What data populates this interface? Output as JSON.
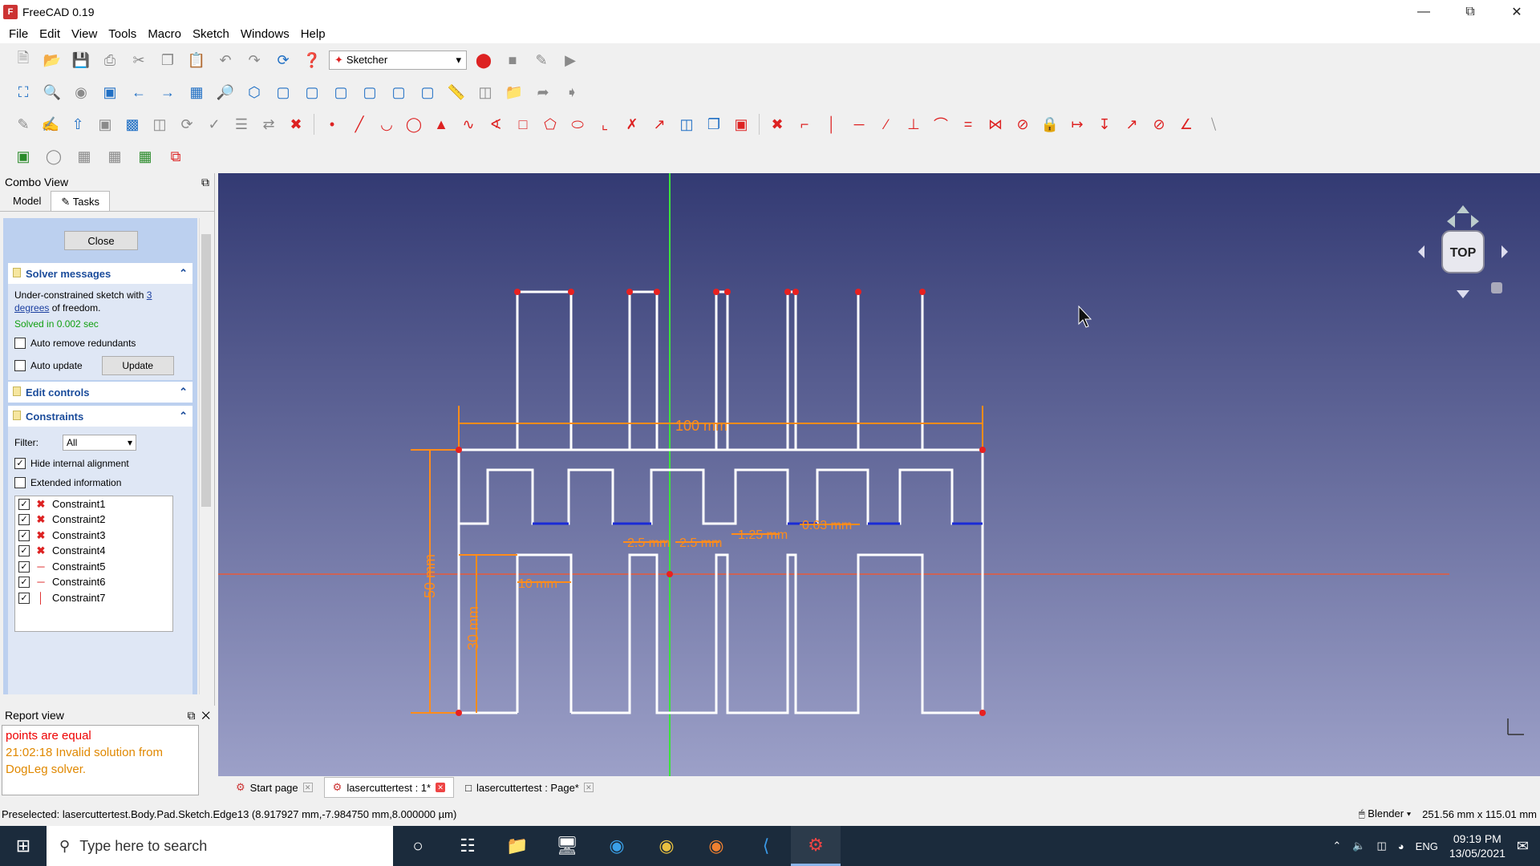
{
  "window": {
    "title": "FreeCAD 0.19"
  },
  "menu": [
    "File",
    "Edit",
    "View",
    "Tools",
    "Macro",
    "Sketch",
    "Windows",
    "Help"
  ],
  "toolbar": {
    "workbench": "Sketcher"
  },
  "combo": {
    "title": "Combo View",
    "tabs": [
      "Model",
      "Tasks"
    ],
    "close_label": "Close",
    "solver": {
      "title": "Solver messages",
      "msg_prefix": "Under-constrained sketch with",
      "msg_link": "3 degrees",
      "msg_suffix": "of freedom.",
      "solved": "Solved in 0.002 sec",
      "auto_remove": "Auto remove redundants",
      "auto_update": "Auto update",
      "update_label": "Update"
    },
    "edit_controls_title": "Edit controls",
    "constraints": {
      "title": "Constraints",
      "filter_label": "Filter:",
      "filter_value": "All",
      "hide_internal": "Hide internal alignment",
      "extended_info": "Extended information",
      "items": [
        "Constraint1",
        "Constraint2",
        "Constraint3",
        "Constraint4",
        "Constraint5",
        "Constraint6",
        "Constraint7"
      ]
    }
  },
  "report": {
    "title": "Report view",
    "line1": "points are equal",
    "line2": "21:02:18  Invalid solution from",
    "line3": "DogLeg solver."
  },
  "view": {
    "navcube_face": "TOP",
    "dims": {
      "width": "100 mm",
      "height": "50 mm",
      "inner_h": "30 mm",
      "slot_w": "10 mm",
      "d1": "2.5 mm",
      "d2": "2.5 mm",
      "d3": "1.25 mm",
      "d4": "0.63 mm"
    }
  },
  "doc_tabs": [
    {
      "label": "Start page"
    },
    {
      "label": "lasercuttertest : 1*"
    },
    {
      "label": "lasercuttertest : Page*"
    }
  ],
  "status": {
    "preselected": "Preselected: lasercuttertest.Body.Pad.Sketch.Edge13 (8.917927 mm,-7.984750 mm,8.000000 µm)",
    "nav_style": "Blender",
    "dimensions": "251.56 mm x 115.01 mm"
  },
  "taskbar": {
    "search_placeholder": "Type here to search",
    "lang": "ENG",
    "time": "09:19 PM",
    "date": "13/05/2021"
  }
}
